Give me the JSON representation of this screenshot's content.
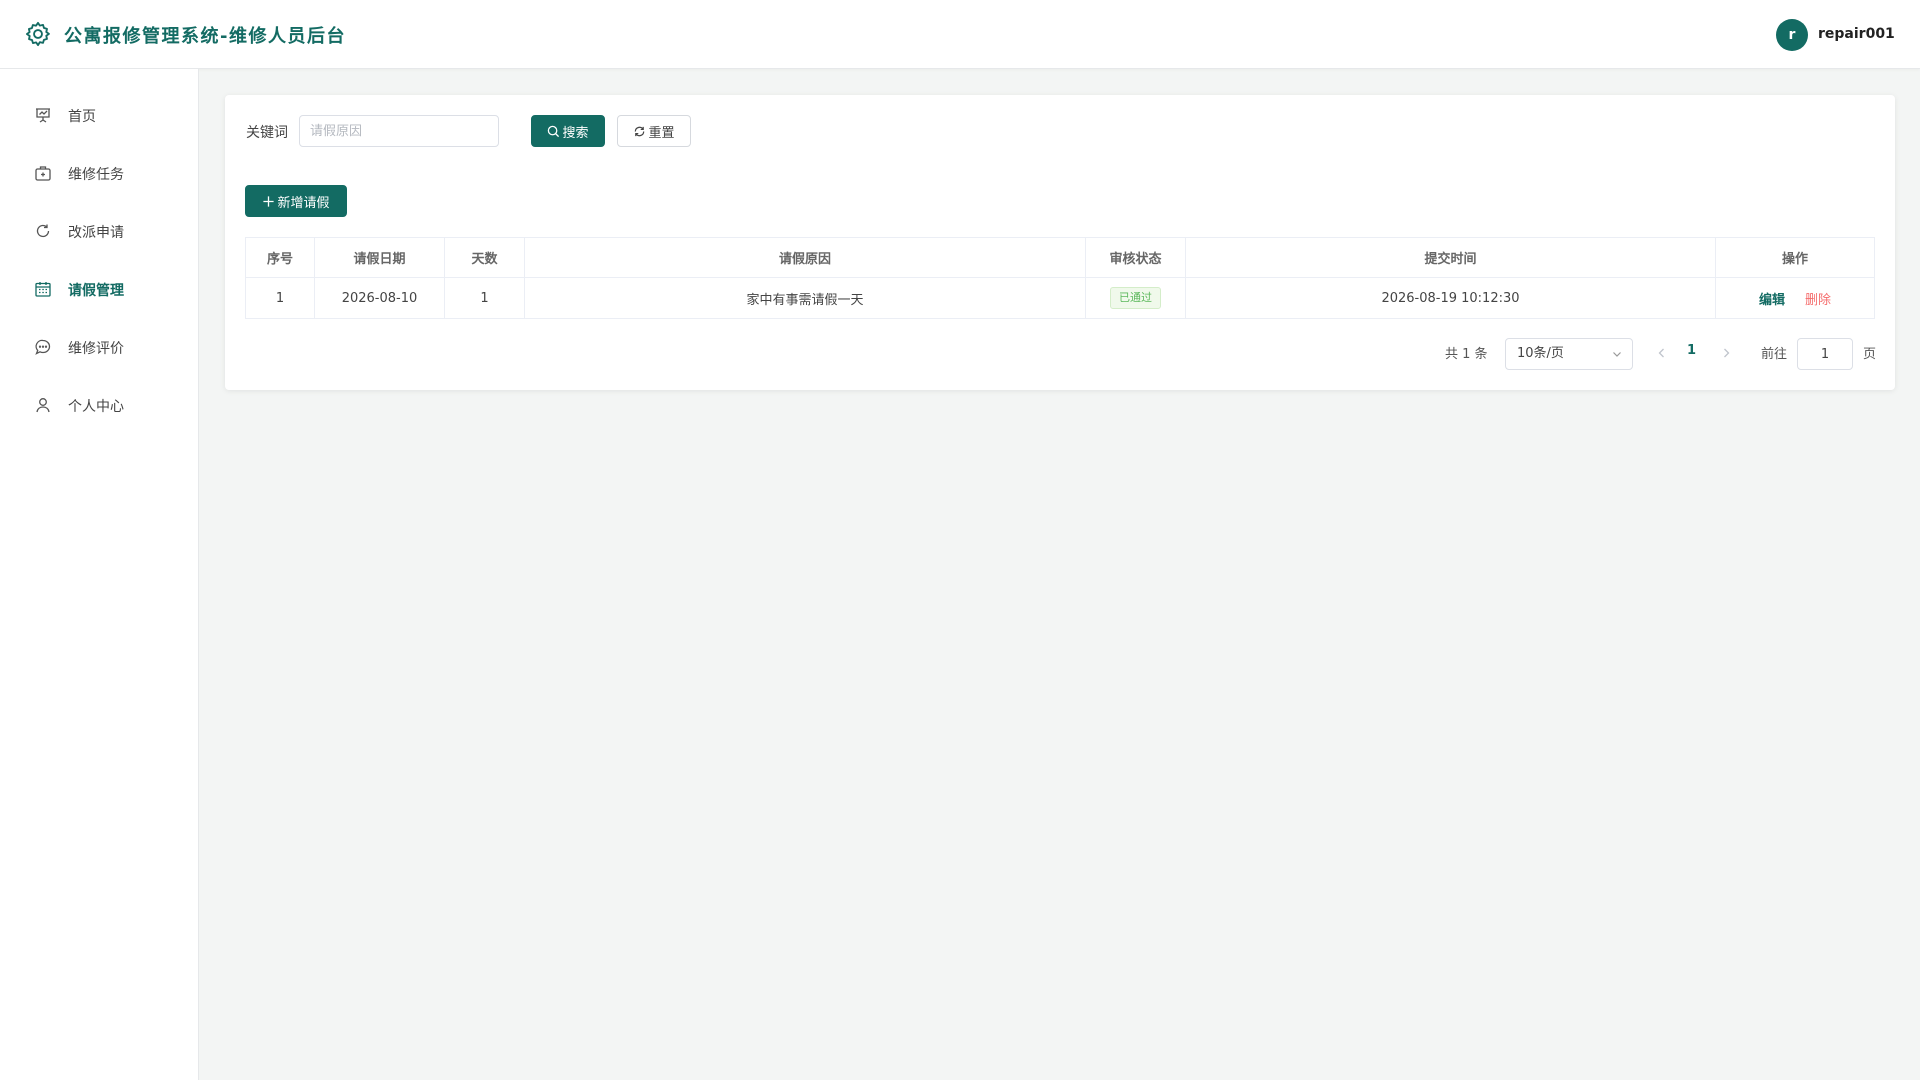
{
  "header": {
    "title": "公寓报修管理系统-维修人员后台",
    "avatar_letter": "r",
    "username": "repair001"
  },
  "sidebar": {
    "items": [
      {
        "label": "首页",
        "icon": "dashboard-icon"
      },
      {
        "label": "维修任务",
        "icon": "toolbox-icon"
      },
      {
        "label": "改派申请",
        "icon": "refresh-icon"
      },
      {
        "label": "请假管理",
        "icon": "calendar-icon",
        "active": true
      },
      {
        "label": "维修评价",
        "icon": "chat-icon"
      },
      {
        "label": "个人中心",
        "icon": "user-icon"
      }
    ]
  },
  "search": {
    "label": "关键词",
    "placeholder": "请假原因",
    "value": "",
    "search_button": "搜索",
    "reset_button": "重置"
  },
  "toolbar": {
    "add_button": "新增请假"
  },
  "table": {
    "columns": [
      "序号",
      "请假日期",
      "天数",
      "请假原因",
      "审核状态",
      "提交时间",
      "操作"
    ],
    "rows": [
      {
        "index": "1",
        "date": "2026-08-10",
        "days": "1",
        "reason": "家中有事需请假一天",
        "status": "已通过",
        "submit_time": "2026-08-19 10:12:30",
        "edit": "编辑",
        "delete": "删除"
      }
    ]
  },
  "pagination": {
    "total_text": "共 1 条",
    "page_size": "10条/页",
    "current_page": "1",
    "goto_label": "前往",
    "goto_value": "1",
    "page_suffix": "页"
  },
  "colors": {
    "primary": "#136b63",
    "danger": "#f56c6c",
    "success": "#5cb85c"
  }
}
